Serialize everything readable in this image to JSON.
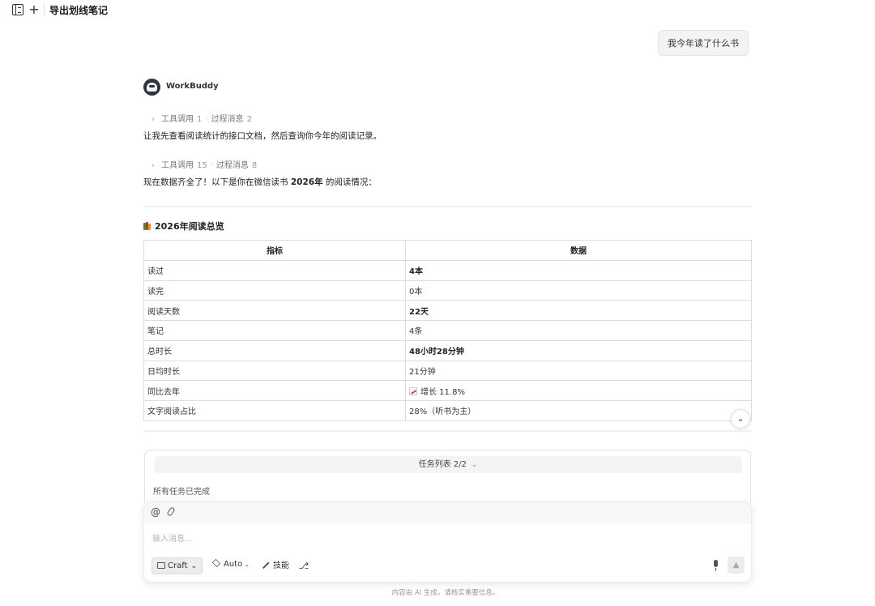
{
  "topbar": {
    "title": "导出划线笔记"
  },
  "user_message": "我今年读了什么书",
  "assistant": {
    "name": "WorkBuddy",
    "step1": {
      "tool_label": "工具调用",
      "tool_count": "1",
      "process_label": "过程消息",
      "process_count": "2"
    },
    "message1": "让我先查看阅读统计的接口文档，然后查询你今年的阅读记录。",
    "step2": {
      "tool_label": "工具调用",
      "tool_count": "15",
      "process_label": "过程消息",
      "process_count": "8"
    },
    "message2": {
      "prefix": "现在数据齐全了！以下是你在微信读书 ",
      "emphasis": "2026年",
      "suffix": " 的阅读情况："
    },
    "section_title": "2026年阅读总览",
    "table": {
      "headers": [
        "指标",
        "数据"
      ],
      "rows": [
        {
          "metric": "读过",
          "value": "4本",
          "bold": true
        },
        {
          "metric": "读完",
          "value": "0本",
          "bold": false
        },
        {
          "metric": "阅读天数",
          "value": "22天",
          "bold": true
        },
        {
          "metric": "笔记",
          "value": "4条",
          "bold": false
        },
        {
          "metric": "总时长",
          "value": "48小时28分钟",
          "bold": true
        },
        {
          "metric": "日均时长",
          "value": "21分钟",
          "bold": false
        },
        {
          "metric": "同比去年",
          "value": "增长 11.8%",
          "bold": false
        },
        {
          "metric": "文字阅读占比",
          "value": "28%（听书为主）",
          "bold": false
        }
      ]
    }
  },
  "task_panel": {
    "header": "任务列表 2/2",
    "status": "所有任务已完成"
  },
  "composer": {
    "placeholder": "输入消息...",
    "mode_label": "Craft",
    "model_label": "Auto",
    "skill_label": "技能"
  },
  "disclaimer": "内容由 AI 生成，请核实重要信息。"
}
